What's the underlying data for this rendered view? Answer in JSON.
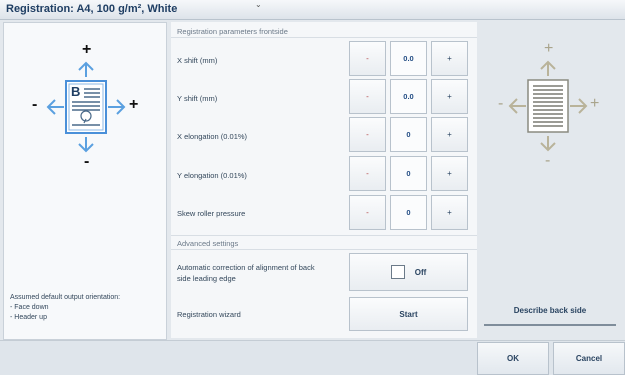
{
  "window": {
    "title": "Registration: A4, 100 g/m², White"
  },
  "front_diagram": {
    "plus_top": "+",
    "plus_right": "+",
    "minus_left": "-",
    "minus_bottom": "-",
    "page_letter": "B"
  },
  "back_diagram": {
    "plus_top": "+",
    "plus_right": "+",
    "minus_left": "-",
    "minus_bottom": "-"
  },
  "orientation_note": {
    "heading": "Assumed default output orientation:",
    "lines": [
      "- Face down",
      "- Header up"
    ]
  },
  "frontside": {
    "section_label": "Registration parameters frontside",
    "params": [
      {
        "label": "X shift (mm)",
        "minus": "-",
        "value": "0.0",
        "plus": "+"
      },
      {
        "label": "Y shift (mm)",
        "minus": "-",
        "value": "0.0",
        "plus": "+"
      },
      {
        "label": "X elongation (0.01%)",
        "minus": "-",
        "value": "0",
        "plus": "+"
      },
      {
        "label": "Y elongation (0.01%)",
        "minus": "-",
        "value": "0",
        "plus": "+"
      },
      {
        "label": "Skew roller pressure",
        "minus": "-",
        "value": "0",
        "plus": "+"
      }
    ]
  },
  "advanced": {
    "section_label": "Advanced settings",
    "auto_correction_label_1": "Automatic correction of alignment of back",
    "auto_correction_label_2": "side leading edge",
    "auto_correction_state": "Off",
    "wizard_label": "Registration wizard",
    "wizard_button": "Start",
    "more": "..."
  },
  "right": {
    "describe_button": "Describe back side"
  },
  "footer": {
    "ok": "OK",
    "cancel": "Cancel"
  },
  "colors": {
    "accent": "#5aa0e0",
    "neutral_arrow": "#b9b39a",
    "title": "#1f3e63"
  }
}
